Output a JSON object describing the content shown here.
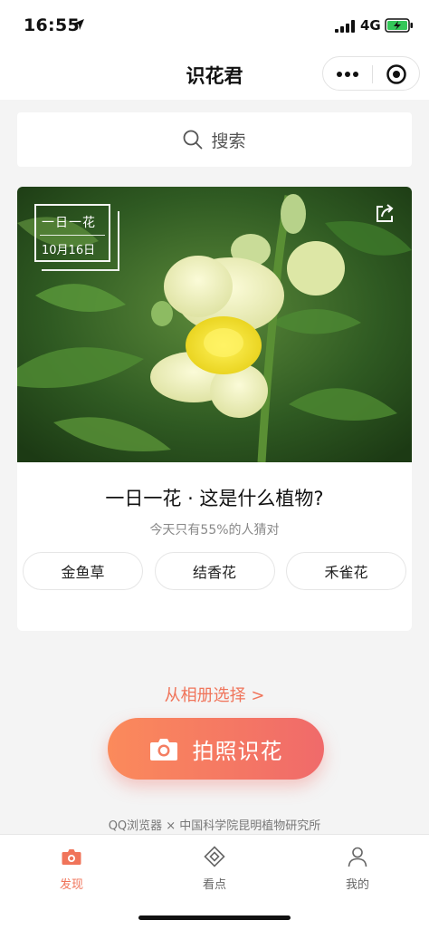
{
  "status_bar": {
    "time": "16:55",
    "network": "4G",
    "icons": [
      "location-arrow-icon",
      "signal-icon",
      "battery-charging-icon"
    ]
  },
  "nav": {
    "title": "识花君",
    "icons": [
      "more-dots-icon",
      "close-target-icon"
    ]
  },
  "search": {
    "label": "搜索",
    "icon": "search-icon"
  },
  "daily_card": {
    "badge_title": "一日一花",
    "badge_date": "10月16日",
    "question": "一日一花 · 这是什么植物?",
    "hint": "今天只有55%的人猜对",
    "options": [
      "金鱼草",
      "结香花",
      "禾雀花"
    ],
    "share_icon": "share-icon"
  },
  "actions": {
    "album_link": "从相册选择 >",
    "capture_label": "拍照识花",
    "capture_icon": "camera-icon",
    "accent_color": "#f0745a"
  },
  "credit": "QQ浏览器 × 中国科学院昆明植物研究所",
  "tabs": [
    {
      "label": "发现",
      "icon": "camera-icon",
      "active": true
    },
    {
      "label": "看点",
      "icon": "diamond-icon",
      "active": false
    },
    {
      "label": "我的",
      "icon": "user-icon",
      "active": false
    }
  ]
}
